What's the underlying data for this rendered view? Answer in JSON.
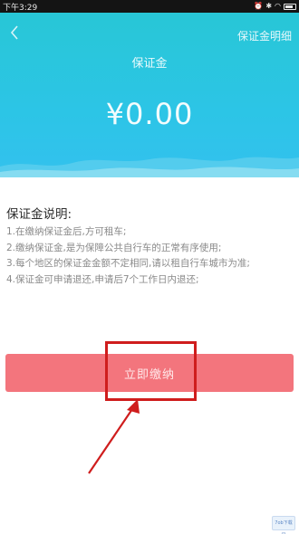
{
  "status_bar": {
    "time": "下午3:29"
  },
  "header": {
    "back_icon": "chevron-left-icon",
    "detail_link": "保证金明细",
    "title": "保证金",
    "amount": "¥0.00",
    "colors": {
      "top": "#28c6d6",
      "bottom": "#33c1ee"
    }
  },
  "description": {
    "title": "保证金说明:",
    "items": [
      "1.在缴纳保证金后,方可租车;",
      "2.缴纳保证金,是为保障公共自行车的正常有序使用;",
      "3.每个地区的保证金金额不定相同,请以租自行车城市为准;",
      "4.保证金可申请退还,申请后7个工作日内退还;"
    ]
  },
  "pay_button": {
    "label": "立即缴纳",
    "color": "#f3757d"
  },
  "annotation": {
    "color": "#cf1d1d"
  },
  "watermark": {
    "text": "7ob下载网"
  }
}
